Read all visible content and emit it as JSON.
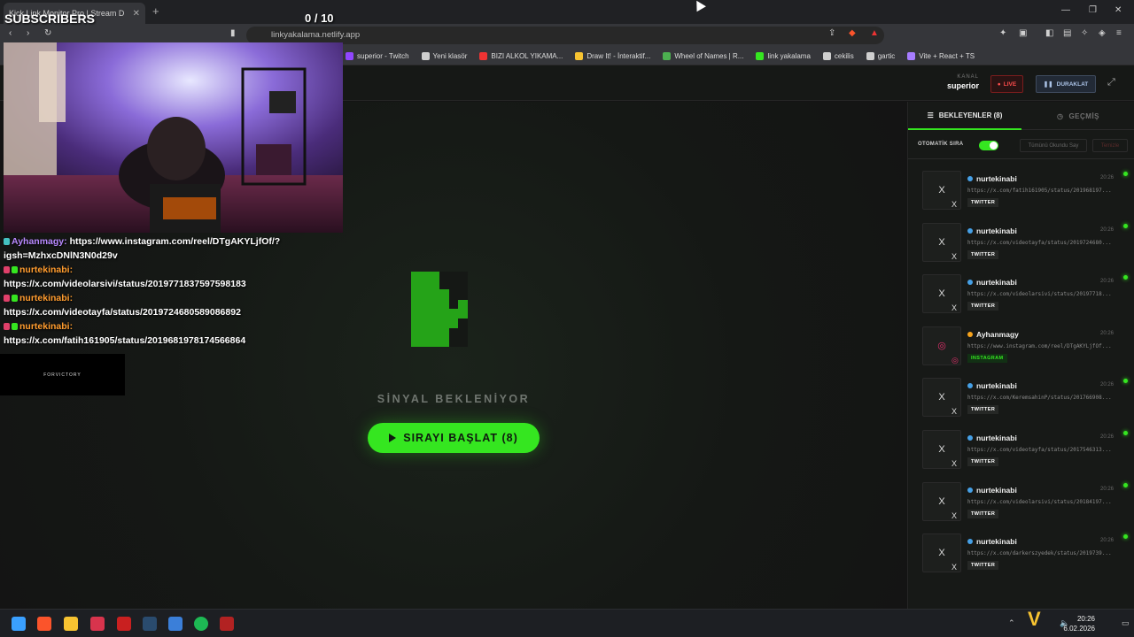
{
  "browser": {
    "tab_title": "Kick Link Monitor Pro | Stream D",
    "url": "linkyakalama.netlify.app",
    "bookmarks": [
      {
        "label": "superior - Twitch",
        "icon_color": "#9146ff"
      },
      {
        "label": "Yeni klasör",
        "icon_color": "#cfcfcf"
      },
      {
        "label": "BIZI ALKOL YIKAMA...",
        "icon_color": "#e33"
      },
      {
        "label": "Draw It! - İnteraktif...",
        "icon_color": "#f7c331"
      },
      {
        "label": "Wheel of Names | R...",
        "icon_color": "#4caf50"
      },
      {
        "label": "link yakalama",
        "icon_color": "#35e620"
      },
      {
        "label": "cekilis",
        "icon_color": "#cfcfcf"
      },
      {
        "label": "gartic",
        "icon_color": "#cfcfcf"
      },
      {
        "label": "Vite + React + TS",
        "icon_color": "#a67cff"
      }
    ]
  },
  "header": {
    "kanal_label": "KANAL",
    "kanal_name": "superior",
    "live_label": "LIVE",
    "pause_label": "DURAKLAT"
  },
  "main": {
    "signal_text": "SİNYAL BEKLENİYOR",
    "start_button": "SIRAYI BAŞLAT (8)",
    "accent": "#35e620"
  },
  "sidebar": {
    "tab_queue": "BEKLEYENLER (8)",
    "tab_history": "GEÇMİŞ",
    "auto_label": "OTOMATİK SIRA",
    "auto_enabled": true,
    "read_all": "Tümünü Okundu Say",
    "clear": "Temizle",
    "items": [
      {
        "user": "nurtekinabi",
        "time": "20:26",
        "url": "https://x.com/fatih161905/status/201968197...",
        "platform": "TWITTER",
        "thumb": "X"
      },
      {
        "user": "nurtekinabi",
        "time": "20:26",
        "url": "https://x.com/videotayfa/status/2019724680...",
        "platform": "TWITTER",
        "thumb": "X"
      },
      {
        "user": "nurtekinabi",
        "time": "20:26",
        "url": "https://x.com/videolarsivi/status/20197718...",
        "platform": "TWITTER",
        "thumb": "X"
      },
      {
        "user": "Ayhanmagy",
        "time": "20:26",
        "url": "https://www.instagram.com/reel/DTgAKYLjfOf...",
        "platform": "INSTAGRAM",
        "thumb": "◎"
      },
      {
        "user": "nurtekinabi",
        "time": "20:26",
        "url": "https://x.com/KeremsahinP/status/201766908...",
        "platform": "TWITTER",
        "thumb": "X"
      },
      {
        "user": "nurtekinabi",
        "time": "20:26",
        "url": "https://x.com/videotayfa/status/2017546313...",
        "platform": "TWITTER",
        "thumb": "X"
      },
      {
        "user": "nurtekinabi",
        "time": "20:26",
        "url": "https://x.com/videolarsivi/status/20184197...",
        "platform": "TWITTER",
        "thumb": "X"
      },
      {
        "user": "nurtekinabi",
        "time": "20:26",
        "url": "https://x.com/darkerszyedek/status/2019739...",
        "platform": "TWITTER",
        "thumb": "X"
      }
    ]
  },
  "overlay": {
    "subscribers_label": "SUBSCRIBERS",
    "counter": "0  / 10",
    "sponsor": "FORVICTORY",
    "chat": [
      {
        "user": "Ayhanmagy:",
        "color": "purple",
        "text": "https://www.instagram.com/reel/DTgAKYLjfOf/?",
        "text2": "igsh=MzhxcDNlN3N0d29v"
      },
      {
        "user": "nurtekinabi:",
        "color": "orange",
        "text": "",
        "text2": "https://x.com/videolarsivi/status/2019771837597598183"
      },
      {
        "user": "nurtekinabi:",
        "color": "orange",
        "text": "",
        "text2": "https://x.com/videotayfa/status/2019724680589086892"
      },
      {
        "user": "nurtekinabi:",
        "color": "orange",
        "text": "",
        "text2": "https://x.com/fatih161905/status/2019681978174566864"
      }
    ]
  },
  "taskbar": {
    "time": "20:26",
    "date": "6.02.2026"
  }
}
